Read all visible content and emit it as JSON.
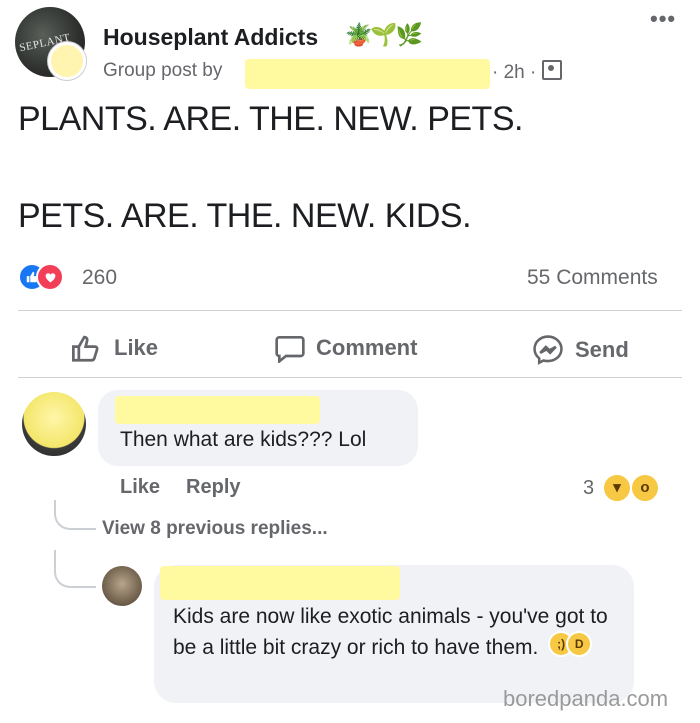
{
  "post": {
    "group_name": "Houseplant Addicts",
    "group_avatar_text": "SEPLANT",
    "group_emojis": "🪴🌱🌿",
    "meta_prefix": "Group post by",
    "meta_time": "· 2h ·",
    "more_icon": "more-options-icon",
    "line1": "PLANTS. ARE. THE. NEW. PETS.",
    "line2": "PETS. ARE. THE. NEW. KIDS.",
    "reaction_count": "260",
    "comments_count": "55 Comments"
  },
  "actions": {
    "like": "Like",
    "comment": "Comment",
    "send": "Send"
  },
  "comment1": {
    "text": "Then what are kids??? Lol",
    "like": "Like",
    "reply": "Reply",
    "reaction_count": "3",
    "view_replies": "View 8 previous replies..."
  },
  "comment2": {
    "text": "Kids are now like exotic animals - you've got to be a little bit crazy or rich to have them."
  },
  "watermark": "boredpanda.com",
  "colors": {
    "like_blue": "#1877f2",
    "love_red": "#f33e58",
    "highlight_yellow": "#fffaa0",
    "meta_gray": "#65676b"
  }
}
